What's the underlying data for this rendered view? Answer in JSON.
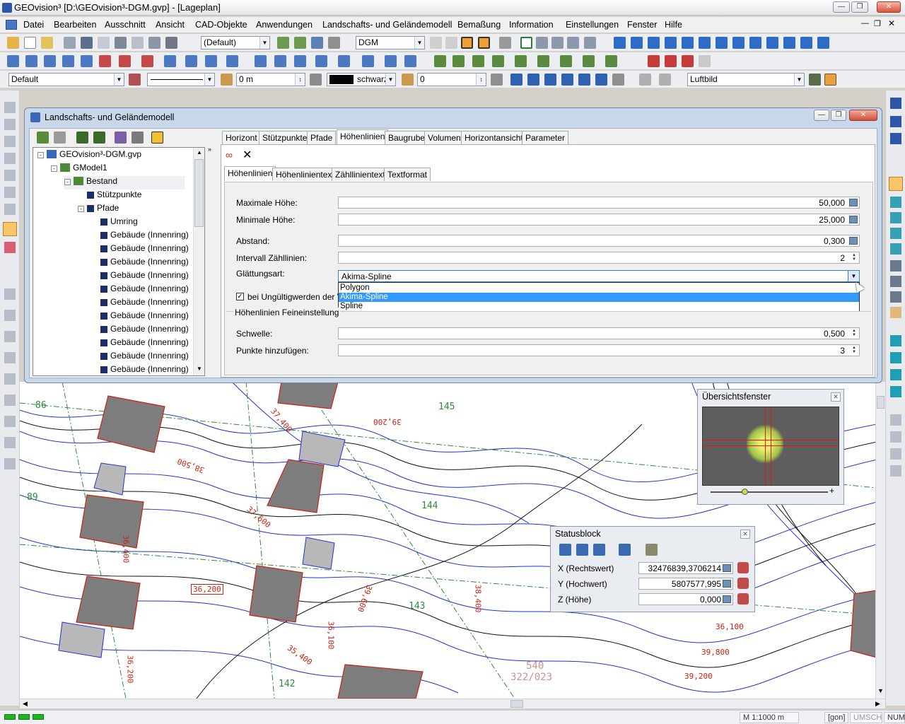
{
  "window": {
    "title": "GEOvision³  [D:\\GEOvision³-DGM.gvp] - [Lageplan]"
  },
  "menu": [
    "Datei",
    "Bearbeiten",
    "Ausschnitt",
    "Ansicht",
    "CAD-Objekte",
    "Anwendungen",
    "Landschafts- und Geländemodell",
    "Bemaßung",
    "Information",
    "Einstellungen",
    "Fenster",
    "Hilfe"
  ],
  "toolbar1": {
    "style_combo": "(Default)",
    "model_combo": "DGM"
  },
  "toolbar3": {
    "layer_combo": "Default",
    "offset_value": "0 m",
    "color_label": "schwarz",
    "value_combo": "0",
    "background_combo": "Luftbild"
  },
  "dialog": {
    "title": "Landschafts- und Geländemodell",
    "tree": [
      {
        "label": "GEOvision³-DGM.gvp",
        "level": 0,
        "exp": "-"
      },
      {
        "label": "GModel1",
        "level": 1,
        "exp": "-"
      },
      {
        "label": "Bestand",
        "level": 2,
        "exp": "-"
      },
      {
        "label": "Stützpunkte",
        "level": 3,
        "exp": ""
      },
      {
        "label": "Pfade",
        "level": 3,
        "exp": "-"
      },
      {
        "label": "Umring",
        "level": 4,
        "exp": ""
      },
      {
        "label": "Gebäude (Innenring)",
        "level": 4,
        "exp": ""
      },
      {
        "label": "Gebäude (Innenring)",
        "level": 4,
        "exp": ""
      },
      {
        "label": "Gebäude (Innenring)",
        "level": 4,
        "exp": ""
      },
      {
        "label": "Gebäude (Innenring)",
        "level": 4,
        "exp": ""
      },
      {
        "label": "Gebäude (Innenring)",
        "level": 4,
        "exp": ""
      },
      {
        "label": "Gebäude (Innenring)",
        "level": 4,
        "exp": ""
      },
      {
        "label": "Gebäude (Innenring)",
        "level": 4,
        "exp": ""
      },
      {
        "label": "Gebäude (Innenring)",
        "level": 4,
        "exp": ""
      },
      {
        "label": "Gebäude (Innenring)",
        "level": 4,
        "exp": ""
      },
      {
        "label": "Gebäude (Innenring)",
        "level": 4,
        "exp": ""
      },
      {
        "label": "Gebäude (Innenring)",
        "level": 4,
        "exp": ""
      }
    ],
    "tabs": [
      "Horizont",
      "Stützpunkte",
      "Pfade",
      "Höhenlinien",
      "Baugrube",
      "Volumen",
      "Horizontansicht",
      "Parameter"
    ],
    "active_tab": "Höhenlinien",
    "subtabs": [
      "Höhenlinien",
      "Höhenlinientext",
      "Zähllinientext",
      "Textformat"
    ],
    "active_subtab": "Höhenlinien",
    "fields": {
      "max_height_label": "Maximale Höhe:",
      "max_height_value": "50,000",
      "min_height_label": "Minimale Höhe:",
      "min_height_value": "25,000",
      "distance_label": "Abstand:",
      "distance_value": "0,300",
      "interval_label": "Intervall Zähllinien:",
      "interval_value": "2",
      "smoothing_label": "Glättungsart:",
      "smoothing_value": "Akima-Spline",
      "checkbox_label": "bei Ungültigwerden der Ver"
    },
    "dropdown_options": [
      "Polygon",
      "Akima-Spline",
      "Spline"
    ],
    "dropdown_selected": "Akima-Spline",
    "fine": {
      "group_label": "Höhenlinien Feineinstellung",
      "threshold_label": "Schwelle:",
      "threshold_value": "0,500",
      "points_label": "Punkte hinzufügen:",
      "points_value": "3"
    }
  },
  "overview": {
    "title": "Übersichtsfenster"
  },
  "statusblock": {
    "title": "Statusblock",
    "x_label": "X  (Rechtswert)",
    "x_value": "32476839,3706214",
    "y_label": "Y  (Hochwert)",
    "y_value": "5807577,995",
    "z_label": "Z  (Höhe)",
    "z_value": "0,000"
  },
  "map_labels": [
    "86",
    "89",
    "145",
    "144",
    "143",
    "142",
    "37,400",
    "39,200",
    "36,200",
    "38,500",
    "37,600",
    "36,100",
    "39,600",
    "35,400",
    "36,200",
    "36,100",
    "39,200",
    "39,800",
    "36,400",
    "38,400",
    "540",
    "322/023"
  ],
  "status": {
    "scale": "M 1:1000  m",
    "unit": "[gon]",
    "caps": "UMSCH",
    "num": "NUM"
  },
  "colors": {
    "dialog_frame": "#c9d7ea",
    "selection": "#3399ff",
    "contour_blue": "#2233cc",
    "building_gray": "#7d7d7d"
  }
}
